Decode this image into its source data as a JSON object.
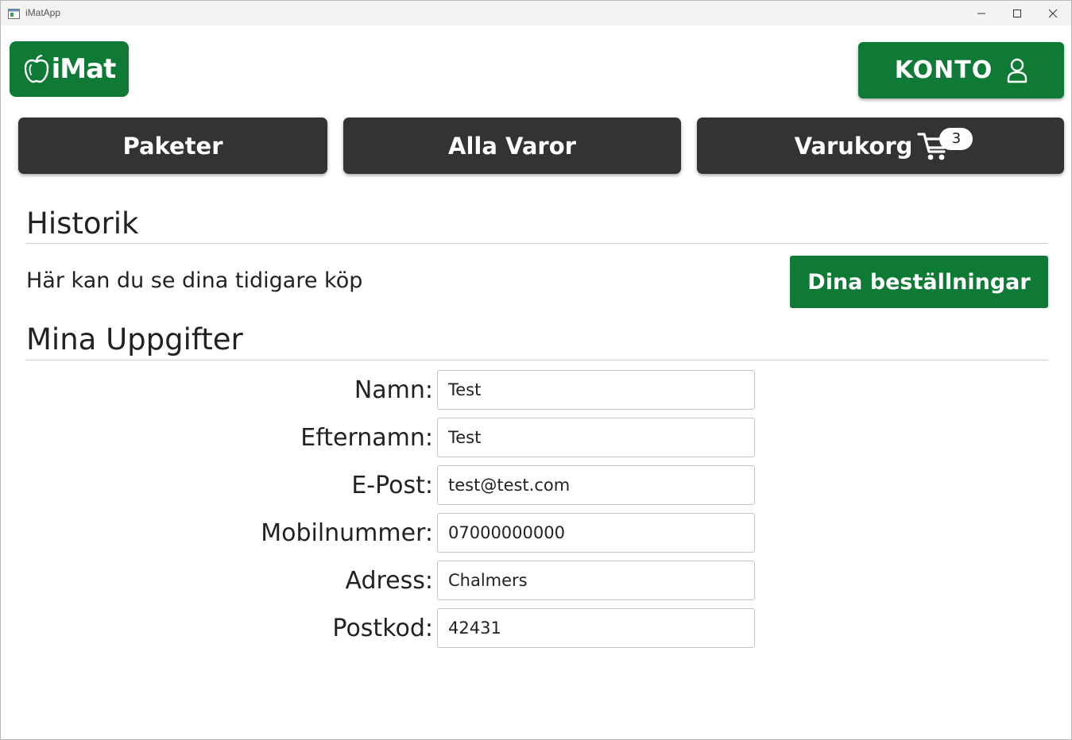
{
  "window": {
    "title": "iMatApp"
  },
  "header": {
    "logo_text": "iMat",
    "konto_label": "KONTO"
  },
  "nav": {
    "paketer": "Paketer",
    "alla_varor": "Alla Varor",
    "varukorg": "Varukorg",
    "cart_count": "3"
  },
  "historik": {
    "title": "Historik",
    "description": "Här kan du se dina tidigare köp",
    "orders_button": "Dina beställningar"
  },
  "mina_uppgifter": {
    "title": "Mina Uppgifter",
    "fields": [
      {
        "label": "Namn:",
        "value": "Test"
      },
      {
        "label": "Efternamn:",
        "value": "Test"
      },
      {
        "label": "E-Post:",
        "value": "test@test.com"
      },
      {
        "label": "Mobilnummer:",
        "value": "07000000000"
      },
      {
        "label": "Adress:",
        "value": "Chalmers"
      },
      {
        "label": "Postkod:",
        "value": "42431"
      }
    ]
  },
  "colors": {
    "brand_green": "#0e7a36",
    "nav_dark": "#333333"
  },
  "icons": [
    "app-icon",
    "minimize-icon",
    "maximize-icon",
    "close-icon",
    "apple-icon",
    "user-icon",
    "cart-icon"
  ]
}
